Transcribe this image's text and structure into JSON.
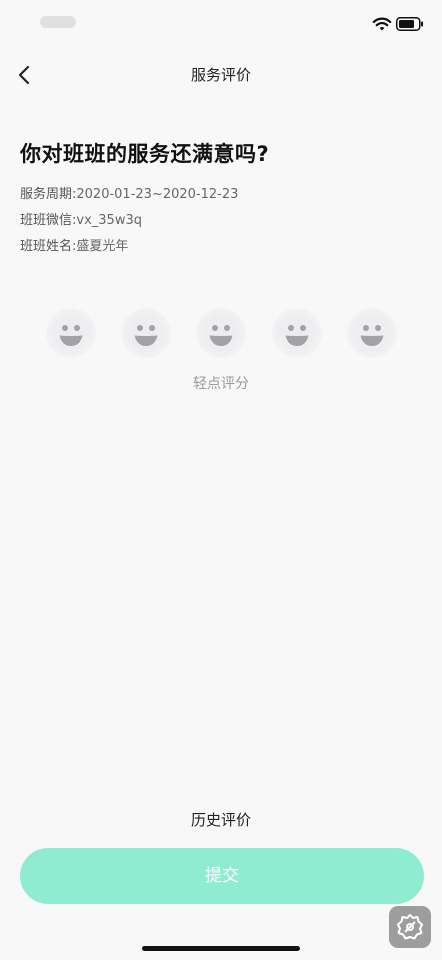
{
  "header": {
    "title": "服务评价",
    "back_icon": "chevron-left-icon"
  },
  "status_bar": {
    "icons": [
      "wifi-icon",
      "battery-icon"
    ]
  },
  "main": {
    "question": "你对班班的服务还满意吗?",
    "info": [
      {
        "label": "服务周期:",
        "value": "2020-01-23~2020-12-23"
      },
      {
        "label": "班班微信:",
        "value": "vx_35w3q"
      },
      {
        "label": "班班姓名:",
        "value": "盛夏光年"
      }
    ],
    "rating": {
      "max": 5,
      "selected": 0,
      "face_icon": "smiley-face-icon",
      "hint": "轻点评分"
    }
  },
  "footer": {
    "history_label": "历史评价",
    "submit_label": "提交",
    "submit_color": "#90ecd0",
    "settings_icon": "gear-icon"
  }
}
